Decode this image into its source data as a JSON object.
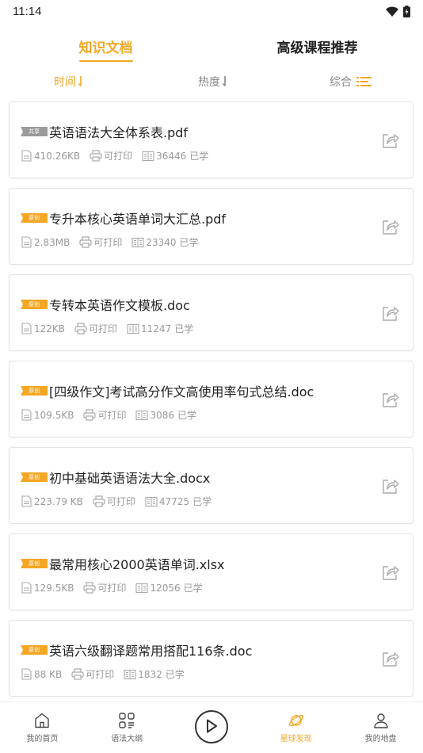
{
  "status_bar": {
    "time": "11:14"
  },
  "top_tabs": [
    {
      "label": "知识文档",
      "active": true
    },
    {
      "label": "高级课程推荐",
      "active": false
    }
  ],
  "sort": [
    {
      "label": "时间",
      "active": true,
      "icon": "arrow-down-icon"
    },
    {
      "label": "热度",
      "active": false,
      "icon": "arrow-down-icon"
    },
    {
      "label": "综合",
      "active": false,
      "icon": "list-icon"
    }
  ],
  "colors": {
    "accent": "#f5a623",
    "share_tag": "#9b9b9b"
  },
  "documents": [
    {
      "tag": "共享",
      "tag_type": "share",
      "title": "英语语法大全体系表.pdf",
      "size": "410.26KB",
      "print": "可打印",
      "learners": "36446",
      "learned_label": "已学"
    },
    {
      "tag": "原创",
      "tag_type": "orig",
      "title": "专升本核心英语单词大汇总.pdf",
      "size": "2.83MB",
      "print": "可打印",
      "learners": "23340",
      "learned_label": "已学"
    },
    {
      "tag": "原创",
      "tag_type": "orig",
      "title": "专转本英语作文模板.doc",
      "size": "122KB",
      "print": "可打印",
      "learners": "11247",
      "learned_label": "已学"
    },
    {
      "tag": "原创",
      "tag_type": "orig",
      "title": "[四级作文]考试高分作文高使用率句式总结.doc",
      "size": "109.5KB",
      "print": "可打印",
      "learners": "3086",
      "learned_label": "已学"
    },
    {
      "tag": "原创",
      "tag_type": "orig",
      "title": "初中基础英语语法大全.docx",
      "size": "223.79 KB",
      "print": "可打印",
      "learners": "47725",
      "learned_label": "已学"
    },
    {
      "tag": "原创",
      "tag_type": "orig",
      "title": "最常用核心2000英语单词.xlsx",
      "size": "129.5KB",
      "print": "可打印",
      "learners": "12056",
      "learned_label": "已学"
    },
    {
      "tag": "原创",
      "tag_type": "orig",
      "title": "英语六级翻译题常用搭配116条.doc",
      "size": "88 KB",
      "print": "可打印",
      "learners": "1832",
      "learned_label": "已学"
    }
  ],
  "bottom_nav": [
    {
      "label": "我的首页",
      "icon": "home-icon",
      "active": false
    },
    {
      "label": "语法大纲",
      "icon": "grid-icon",
      "active": false
    },
    {
      "label": "",
      "icon": "play-icon",
      "active": false
    },
    {
      "label": "星球发现",
      "icon": "planet-icon",
      "active": true
    },
    {
      "label": "我的地盘",
      "icon": "user-icon",
      "active": false
    }
  ]
}
